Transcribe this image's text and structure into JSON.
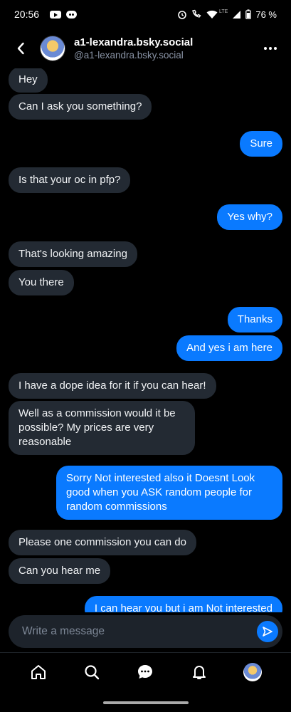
{
  "status_bar": {
    "time": "20:56",
    "signal_label": "LTE",
    "battery": "76 %"
  },
  "header": {
    "display_name": "a1-lexandra.bsky.social",
    "handle": "@a1-lexandra.bsky.social"
  },
  "messages": [
    {
      "from": "them",
      "text": "Hey"
    },
    {
      "from": "them",
      "text": "Can I ask you something?"
    },
    {
      "from": "me",
      "text": "Sure"
    },
    {
      "from": "them",
      "text": "Is that your oc in pfp?"
    },
    {
      "from": "me",
      "text": "Yes why?"
    },
    {
      "from": "them",
      "text": "That's looking amazing"
    },
    {
      "from": "them",
      "text": "You there"
    },
    {
      "from": "me",
      "text": "Thanks"
    },
    {
      "from": "me",
      "text": "And yes i am here"
    },
    {
      "from": "them",
      "text": "I have a dope idea for it if you can hear!"
    },
    {
      "from": "them",
      "text": "Well as a commission would it be possible? My prices are very reasonable"
    },
    {
      "from": "me",
      "text": "Sorry Not interested also it Doesnt Look good when you ASK random people for random commissions"
    },
    {
      "from": "them",
      "text": "Please one commission you can do"
    },
    {
      "from": "them",
      "text": "Can you hear me"
    },
    {
      "from": "me",
      "text": "I can hear you but i am Not interested"
    }
  ],
  "composer": {
    "placeholder": "Write a message"
  },
  "colors": {
    "accent": "#0a7aff",
    "incoming_bubble": "#232a33",
    "background": "#000000"
  }
}
